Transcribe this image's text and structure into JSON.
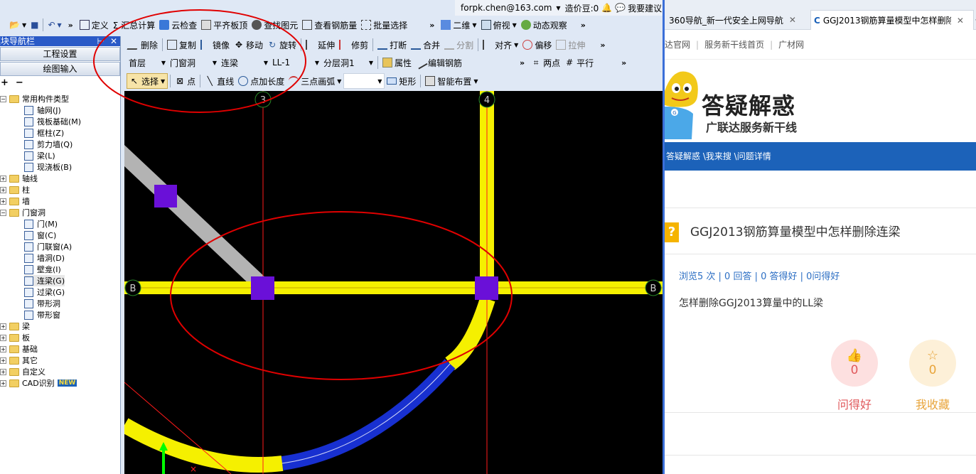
{
  "app": {
    "title_strip": {
      "email": "forpk.chen@163.com",
      "beans": "造价豆:0",
      "suggest": "我要建议"
    },
    "toolbar1": [
      {
        "label": "定义"
      },
      {
        "label": "Σ 汇总计算"
      },
      {
        "label": "云检查"
      },
      {
        "label": "平齐板顶"
      },
      {
        "label": "查找图元"
      },
      {
        "label": "查看钢筋量"
      },
      {
        "label": "批量选择"
      }
    ],
    "toolbar1_right": {
      "view2d": "二维",
      "view_top": "俯视",
      "dynamic": "动态观察"
    },
    "toolbar2": [
      {
        "label": "删除"
      },
      {
        "label": "复制"
      },
      {
        "label": "镜像"
      },
      {
        "label": "移动"
      },
      {
        "label": "旋转"
      },
      {
        "label": "延伸"
      },
      {
        "label": "修剪"
      },
      {
        "label": "打断"
      },
      {
        "label": "合并"
      },
      {
        "label": "分割"
      },
      {
        "label": "对齐"
      },
      {
        "label": "偏移"
      },
      {
        "label": "拉伸"
      }
    ],
    "toolbar3": {
      "floor": "首层",
      "category": "门窗洞",
      "type": "连梁",
      "component": "LL-1",
      "layer": "分层洞1",
      "properties": "属性",
      "edit_rebar": "编辑钢筋",
      "two_points": "两点",
      "parallel": "平行"
    },
    "toolbar4": [
      {
        "label": "选择"
      },
      {
        "label": "点"
      },
      {
        "label": "直线"
      },
      {
        "label": "点加长度"
      },
      {
        "label": "三点画弧"
      },
      {
        "label": "矩形"
      },
      {
        "label": "智能布置"
      }
    ],
    "nav": {
      "header": "模块导航栏",
      "btn_project": "工程设置",
      "btn_draw": "绘图输入",
      "tree": [
        {
          "label": "常用构件类型",
          "kind": "folder",
          "expanded": true,
          "level": 0
        },
        {
          "label": "轴网(J)",
          "kind": "leaf",
          "level": 1
        },
        {
          "label": "筏板基础(M)",
          "kind": "leaf",
          "level": 1
        },
        {
          "label": "框柱(Z)",
          "kind": "leaf",
          "level": 1
        },
        {
          "label": "剪力墙(Q)",
          "kind": "leaf",
          "level": 1
        },
        {
          "label": "梁(L)",
          "kind": "leaf",
          "level": 1
        },
        {
          "label": "现浇板(B)",
          "kind": "leaf",
          "level": 1
        },
        {
          "label": "轴线",
          "kind": "folder",
          "expanded": false,
          "level": 0
        },
        {
          "label": "柱",
          "kind": "folder",
          "expanded": false,
          "level": 0
        },
        {
          "label": "墙",
          "kind": "folder",
          "expanded": false,
          "level": 0
        },
        {
          "label": "门窗洞",
          "kind": "folder",
          "expanded": true,
          "level": 0
        },
        {
          "label": "门(M)",
          "kind": "leaf",
          "level": 1
        },
        {
          "label": "窗(C)",
          "kind": "leaf",
          "level": 1
        },
        {
          "label": "门联窗(A)",
          "kind": "leaf",
          "level": 1
        },
        {
          "label": "墙洞(D)",
          "kind": "leaf",
          "level": 1
        },
        {
          "label": "壁龛(I)",
          "kind": "leaf",
          "level": 1
        },
        {
          "label": "连梁(G)",
          "kind": "leaf",
          "level": 1,
          "selected": true
        },
        {
          "label": "过梁(G)",
          "kind": "leaf",
          "level": 1
        },
        {
          "label": "带形洞",
          "kind": "leaf",
          "level": 1
        },
        {
          "label": "带形窗",
          "kind": "leaf",
          "level": 1
        },
        {
          "label": "梁",
          "kind": "folder",
          "expanded": false,
          "level": 0
        },
        {
          "label": "板",
          "kind": "folder",
          "expanded": false,
          "level": 0
        },
        {
          "label": "基础",
          "kind": "folder",
          "expanded": false,
          "level": 0
        },
        {
          "label": "其它",
          "kind": "folder",
          "expanded": false,
          "level": 0
        },
        {
          "label": "自定义",
          "kind": "folder",
          "expanded": false,
          "level": 0
        },
        {
          "label": "CAD识别",
          "kind": "folder",
          "expanded": false,
          "level": 0,
          "badge": "NEW"
        }
      ]
    },
    "canvas": {
      "axis_labels": [
        "3",
        "4",
        "B",
        "B"
      ]
    },
    "colors": {
      "beam": "#f5f000",
      "column": "#6a10d8",
      "arc_blue": "#1830d0",
      "wall": "#b3b3b3",
      "annotation": "#e00000"
    }
  },
  "browser": {
    "tabs": [
      {
        "label": "360导航_新一代安全上网导航"
      },
      {
        "label": "GGJ2013钢筋算量模型中怎样删除"
      }
    ],
    "links": [
      "达官网",
      "服务新干线首页",
      "广材网"
    ],
    "logo": {
      "title": "答疑解惑",
      "subtitle": "广联达服务新干线"
    },
    "breadcrumb": "答疑解惑 \\我来搜 \\问题详情",
    "question": {
      "title": "GGJ2013钢筋算量模型中怎样删除连梁",
      "stats": "浏览5 次 | 0 回答 | 0 答得好 | 0问得好",
      "body": "怎样删除GGJ2013算量中的LL梁"
    },
    "votes": [
      {
        "count": "0",
        "label": "问得好"
      },
      {
        "count": "0",
        "label": "我收藏"
      }
    ]
  }
}
